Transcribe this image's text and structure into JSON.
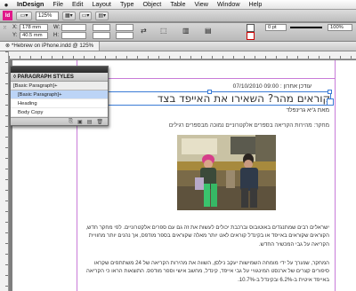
{
  "menubar": {
    "apple": "",
    "items": [
      "InDesign",
      "File",
      "Edit",
      "Layout",
      "Type",
      "Object",
      "Table",
      "View",
      "Window",
      "Help"
    ]
  },
  "appbar": {
    "logo": "Id",
    "zoom": "125%",
    "view_label": "▾"
  },
  "control": {
    "x_label": "X:",
    "y_label": "Y:",
    "x_value": "178 mm",
    "y_value": "40.5 mm",
    "w_label": "W:",
    "h_label": "H:",
    "stroke_weight": "0 pt",
    "opacity": "100%"
  },
  "document_tab": {
    "label": "*Hebrew on iPhone.indd @ 125%"
  },
  "paragraph_styles": {
    "title": "◊ PARAGRAPH STYLES",
    "current": "[Basic Paragraph]+",
    "items": [
      {
        "label": "[Basic Paragraph]+",
        "selected": true
      },
      {
        "label": "Heading",
        "selected": false
      },
      {
        "label": "Body Copy",
        "selected": false
      }
    ],
    "footer_icons": [
      "⎘",
      "▣",
      "▤",
      "🗑"
    ]
  },
  "article": {
    "byline": "עודכן אחרון : 09:00 07/10/2010",
    "headline": "קוראים מהר? השאירו את האייפד בצד",
    "author": "מאת ג'יא גרינפלד",
    "lead": "מחקר: מהירות הקריאה בספרים אלקטרוניים נמוכה מבספרים רגילים",
    "body1": "ישראלים רבים שמתנגדים באוטובוס וברכבת יכולים לעשות את זה גם עם ספרים אלקטרוניים. לפי מחקר חדש, הקוראים שקוראים באייפד או בקינדל קוראים לאט יותר מאלה שקוראים בספר מודפס, אך נהנים יותר מחוויית הקריאה על גבי המכשיר החדש.",
    "body2": "המחקר, שנערך על ידי מומחה השמישות יעקב נילסן, השווה את מהירות הקריאה של 24 משתתפים שקראו סיפורים קצרים של ארנסט המינגוויי על גבי אייפד, קינדל, מחשב אישי וספר מודפס. התוצאות הראו כי הקריאה באייפד איטית ב-6.2% ובקינדל ב-10.7%."
  },
  "colors": {
    "selection": "#3a7bd5",
    "margin_guide": "#c87bd8",
    "logo": "#e0198a"
  }
}
